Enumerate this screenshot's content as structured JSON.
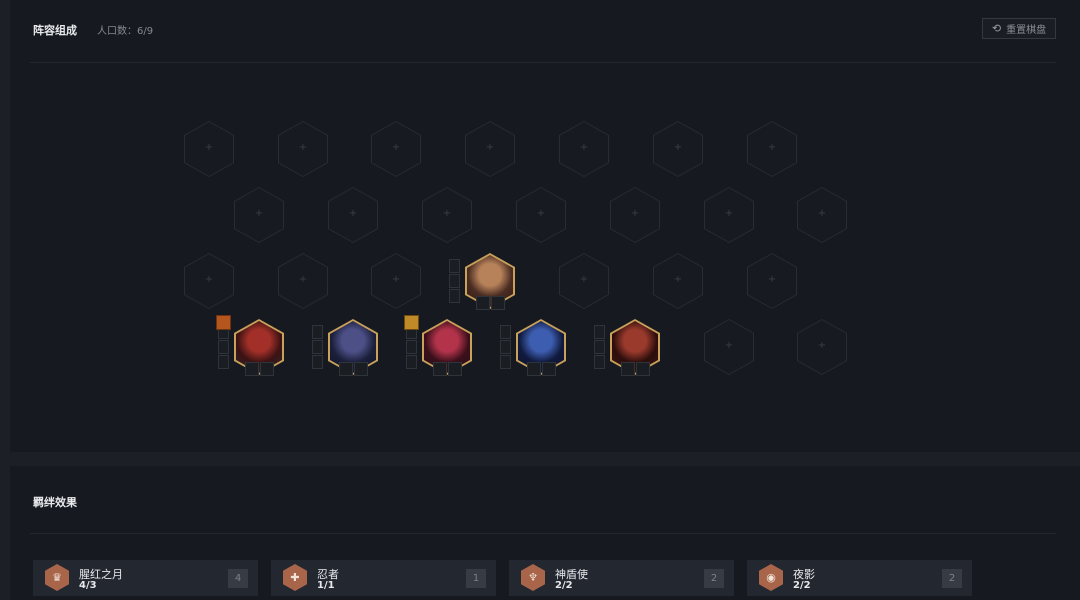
{
  "board": {
    "title": "阵容组成",
    "population": "人口数：6/9",
    "reset_label": "重置棋盘",
    "reset_icon": "refresh-icon"
  },
  "slot_glyph": "+",
  "champions": [
    {
      "name": "champion-brawler",
      "colors": [
        "#4a2c22",
        "#b7825a",
        "#2a1a15"
      ],
      "equip": false
    },
    {
      "name": "champion-red-mask",
      "colors": [
        "#3c1213",
        "#a23028",
        "#2a2b30"
      ],
      "equip": "orange"
    },
    {
      "name": "champion-shadow",
      "colors": [
        "#1b1f3a",
        "#4d5087",
        "#101224"
      ],
      "equip": false
    },
    {
      "name": "champion-crimson",
      "colors": [
        "#3a0f1a",
        "#b2334a",
        "#241221"
      ],
      "equip": "gold"
    },
    {
      "name": "champion-blue-mage",
      "colors": [
        "#101a3d",
        "#3d5db0",
        "#0d132a"
      ],
      "equip": false
    },
    {
      "name": "champion-red-beast",
      "colors": [
        "#2d0e0c",
        "#9a3a2c",
        "#3a1714"
      ],
      "equip": false
    }
  ],
  "traits": {
    "title": "羁绊效果",
    "items": [
      {
        "name": "腥红之月",
        "count": "4/3",
        "badge": "4",
        "icon": "crimson-moon-icon",
        "glyph": "♛"
      },
      {
        "name": "忍者",
        "count": "1/1",
        "badge": "1",
        "icon": "ninja-shuriken-icon",
        "glyph": "✚"
      },
      {
        "name": "神盾使",
        "count": "2/2",
        "badge": "2",
        "icon": "aegis-icon",
        "glyph": "♆"
      },
      {
        "name": "夜影",
        "count": "2/2",
        "badge": "2",
        "icon": "night-shadow-icon",
        "glyph": "◉"
      }
    ]
  },
  "colors": {
    "background": "#1c1f26",
    "panel": "#161a20",
    "champion_frame": "#c9a15a",
    "trait_icon": "#a8654a"
  }
}
